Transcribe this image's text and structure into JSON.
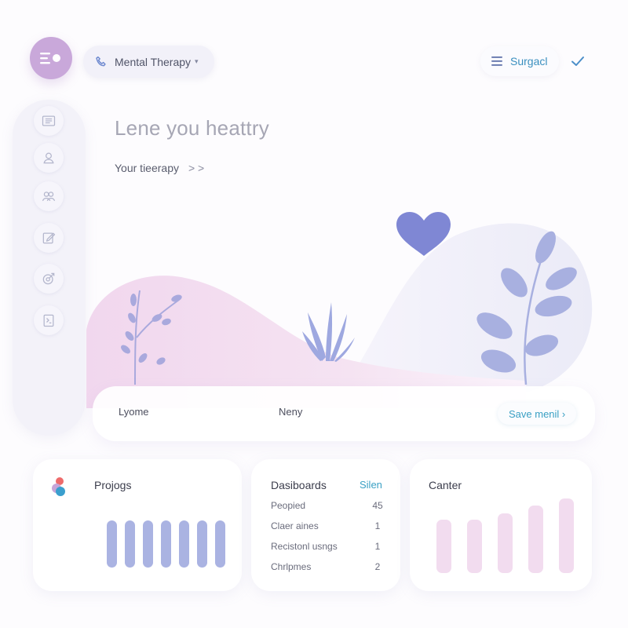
{
  "header": {
    "service_label": "Mental Therapy",
    "right_action_label": "Surgacl",
    "icons": [
      "menu-dot-icon",
      "phone-icon",
      "chevron-down-icon",
      "list-icon",
      "check-icon"
    ]
  },
  "sidebar": {
    "items": [
      {
        "name": "dashboard",
        "icon": "list-card-icon"
      },
      {
        "name": "profile",
        "icon": "user-icon"
      },
      {
        "name": "community",
        "icon": "group-icon"
      },
      {
        "name": "journal",
        "icon": "edit-icon"
      },
      {
        "name": "progress",
        "icon": "target-icon"
      },
      {
        "name": "reports",
        "icon": "document-icon"
      }
    ]
  },
  "hero": {
    "title": "Lene you heattry",
    "link_label": "Your tieerapy",
    "link_chevrons": ">  >"
  },
  "info_strip": {
    "left_text": "Lyome",
    "middle_text": "Neny",
    "button_label": "Save menil ›"
  },
  "cards": {
    "projects": {
      "title": "Projogs",
      "bar_levels": [
        1,
        1,
        1,
        1,
        1,
        1,
        1
      ]
    },
    "dashboards": {
      "title": "Dasiboards",
      "action": "Silen",
      "rows": [
        {
          "label": "Peopied",
          "value": "45"
        },
        {
          "label": "Claer aines",
          "value": "1"
        },
        {
          "label": "Recistonl usngs",
          "value": "1"
        },
        {
          "label": "Chrlpmes",
          "value": "2"
        }
      ]
    },
    "center": {
      "title": "Canter",
      "bar_levels": [
        0.72,
        0.72,
        0.8,
        0.9,
        1
      ]
    }
  },
  "colors": {
    "accent_purple": "#c9a8da",
    "accent_blue": "#3aa0c4",
    "lavender": "#aab3e2",
    "pink": "#f2dcef",
    "heart": "#7f87d4"
  }
}
